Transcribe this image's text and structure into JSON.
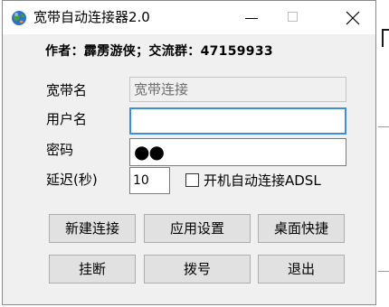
{
  "window": {
    "title": "宽带自动连接器2.0",
    "icon": "globe-app-icon",
    "controls": {
      "minimize": "minimize-icon",
      "maximize": "maximize-icon",
      "close": "close-icon"
    }
  },
  "author_line": "作者：霹雳游侠；交流群：47159933",
  "form": {
    "connection_name_label": "宽带名",
    "connection_name_value": "宽带连接",
    "username_label": "用户名",
    "username_value": "",
    "password_label": "密码",
    "password_value": "●●",
    "delay_label": "延迟(秒)",
    "delay_value": "10",
    "autoconnect_label": "开机自动连接ADSL",
    "autoconnect_checked": false
  },
  "buttons": {
    "new_connection": "新建连接",
    "apply_settings": "应用设置",
    "desktop_shortcut": "桌面快捷",
    "hang_up": "挂断",
    "dial": "拨号",
    "exit": "退出"
  },
  "colors": {
    "focus_border": "#3b8ed8",
    "button_face": "#e1e1e1",
    "window_bg": "#f0f0f0"
  }
}
